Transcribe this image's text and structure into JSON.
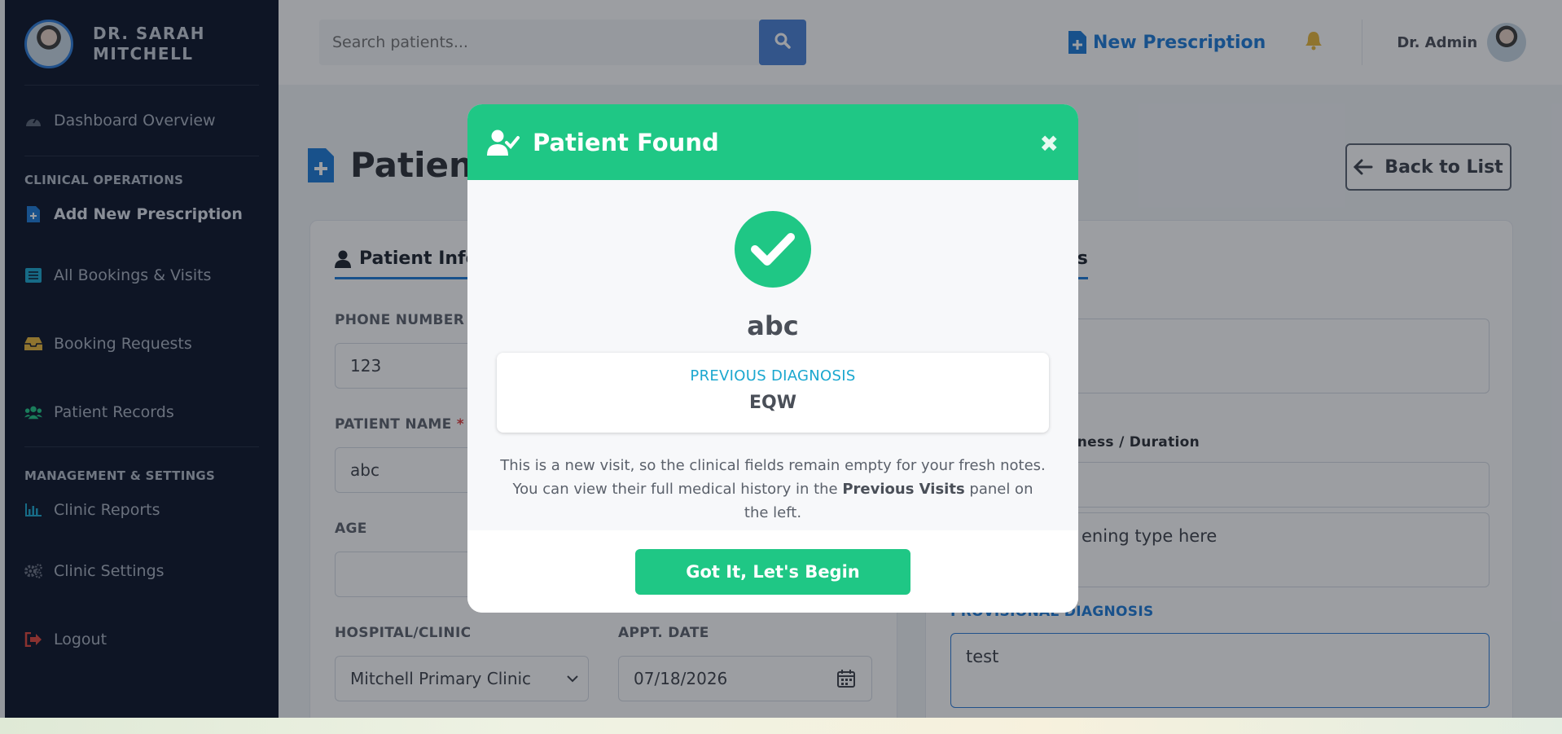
{
  "sidebar": {
    "doctor_name_line1": "DR. SARAH",
    "doctor_name_line2": "MITCHELL",
    "items": [
      {
        "label": "Dashboard Overview",
        "icon": "gauge-icon"
      },
      {
        "label": "Add New Prescription",
        "icon": "file-plus-icon"
      },
      {
        "label": "All Bookings & Visits",
        "icon": "list-icon"
      },
      {
        "label": "Booking Requests",
        "icon": "inbox-icon"
      },
      {
        "label": "Patient Records",
        "icon": "users-icon"
      },
      {
        "label": "Clinic Reports",
        "icon": "bar-chart-icon"
      },
      {
        "label": "Clinic Settings",
        "icon": "gears-icon"
      },
      {
        "label": "Logout",
        "icon": "sign-out-icon"
      }
    ],
    "section_clinical": "CLINICAL OPERATIONS",
    "section_management": "MANAGEMENT & SETTINGS"
  },
  "header": {
    "search_placeholder": "Search patients...",
    "new_prescription": "New Prescription",
    "user_name": "Dr. Admin"
  },
  "page": {
    "title": "Patient",
    "back_label": "Back to List",
    "left_tab": "Patient Infor",
    "right_tab": "res",
    "phone_label": "PHONE NUMBER (S",
    "phone_value": "123",
    "name_label": "PATIENT NAME",
    "name_required": "*",
    "name_value": "abc",
    "age_label": "AGE",
    "hospital_label": "HOSPITAL/CLINIC",
    "hospital_value": "Mitchell Primary Clinic",
    "date_label": "APPT. DATE",
    "date_value": "07/18/2026",
    "illness_label": "r Illness / Duration",
    "screening_text": "ening type here",
    "provisional_label": "PROVISIONAL DIAGNOSIS",
    "provisional_value": "test"
  },
  "modal": {
    "title": "Patient Found",
    "patient_name": "abc",
    "diagnosis_label": "PREVIOUS DIAGNOSIS",
    "diagnosis_value": "EQW",
    "note_part1": "This is a new visit, so the clinical fields remain empty for your fresh notes. You can view their full medical history in the ",
    "note_bold": "Previous Visits",
    "note_part2": " panel on the left.",
    "cta": "Got It, Let's Begin"
  },
  "colors": {
    "sidebar_bg": "#0c1429",
    "accent_blue": "#1d7ad8",
    "success_green": "#1fc785",
    "search_button": "#4b82d6"
  }
}
